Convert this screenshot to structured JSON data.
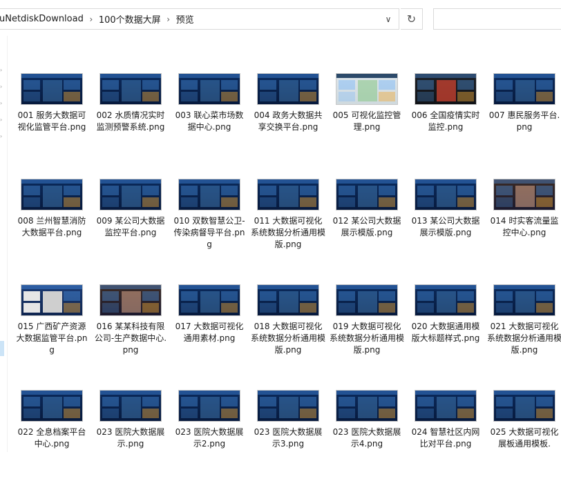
{
  "address_bar": {
    "breadcrumbs": [
      "uNetdiskDownload",
      "100个数据大屏",
      "预览"
    ]
  },
  "files": [
    {
      "label": "001 服务大数据可视化监管平台.png",
      "thumb": "dark-blue"
    },
    {
      "label": "002 水质情况实时监测预警系统.png",
      "thumb": "dark-blue"
    },
    {
      "label": "003 联心菜市场数据中心.png",
      "thumb": "dark-blue"
    },
    {
      "label": "004 政务大数据共享交换平台.png",
      "thumb": "dark-blue"
    },
    {
      "label": "005 可视化监控管理.png",
      "thumb": "light"
    },
    {
      "label": "006 全国疫情实时监控.png",
      "thumb": "dark"
    },
    {
      "label": "007 惠民服务平台.png",
      "thumb": "dark-blue"
    },
    {
      "label": "008 兰州智慧消防大数据平台.png",
      "thumb": "dark-blue"
    },
    {
      "label": "009 某公司大数据监控平台.png",
      "thumb": "dark-blue"
    },
    {
      "label": "010 双数智慧公卫-传染病督导平台.png",
      "thumb": "dark-blue"
    },
    {
      "label": "011 大数据可视化系统数据分析通用模版.png",
      "thumb": "dark-blue"
    },
    {
      "label": "012 某公司大数据展示模版.png",
      "thumb": "dark-blue"
    },
    {
      "label": "013 某公司大数据展示模版.png",
      "thumb": "dark-blue"
    },
    {
      "label": "014 时实客流量监控中心.png",
      "thumb": "photo"
    },
    {
      "label": "015 广西矿产资源大数据监管平台.png",
      "thumb": "gray"
    },
    {
      "label": "016 某某科技有限公司-生产数据中心.png",
      "thumb": "photo"
    },
    {
      "label": "017 大数据可视化通用素材.png",
      "thumb": "dark-blue"
    },
    {
      "label": "018 大数据可视化系统数据分析通用模版.png",
      "thumb": "dark-blue"
    },
    {
      "label": "019 大数据可视化系统数据分析通用模版.png",
      "thumb": "dark-blue"
    },
    {
      "label": "020 大数据通用模版大标题样式.png",
      "thumb": "dark-blue"
    },
    {
      "label": "021 大数据可视化系统数据分析通用模版.png",
      "thumb": "dark-blue"
    },
    {
      "label": "022 全息档案平台中心.png",
      "thumb": "dark-blue"
    },
    {
      "label": "023 医院大数据展示.png",
      "thumb": "dark-blue"
    },
    {
      "label": "023 医院大数据展示2.png",
      "thumb": "dark-blue"
    },
    {
      "label": "023 医院大数据展示3.png",
      "thumb": "dark-blue"
    },
    {
      "label": "023 医院大数据展示4.png",
      "thumb": "dark-blue"
    },
    {
      "label": "024 智慧社区内网比对平台.png",
      "thumb": "dark-blue"
    },
    {
      "label": "025 大数据可视化展板通用模板.",
      "thumb": "dark-blue"
    }
  ],
  "icons": {
    "breadcrumb_separator": "chevron-right-icon",
    "address_dropdown": "chevron-down-icon",
    "refresh": "refresh-icon",
    "nav_expand": "chevron-right-icon"
  },
  "colors": {
    "selection": "#cce4f7",
    "border": "#d9d9d9",
    "thumb_bg": "#0b2a5c"
  }
}
